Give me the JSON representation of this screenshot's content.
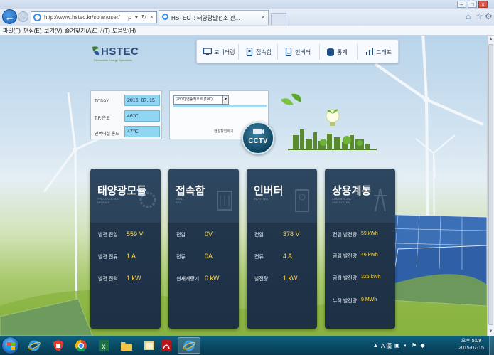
{
  "browser": {
    "url": "http://www.hstec.kr/solar/user/",
    "tab_title": "HSTEC :: 태양광발전소 관...",
    "tab_close": "×",
    "menu": [
      "파일(F)",
      "편집(E)",
      "보기(V)",
      "즐겨찾기(A)",
      "도구(T)",
      "도움말(H)"
    ],
    "address_tools": "ρ ▾ ↻ ×",
    "window_controls": [
      "–",
      "□",
      "×"
    ]
  },
  "logo": {
    "text": "HSTEC",
    "subtext": "Renewable Energy Specialists"
  },
  "nav": [
    {
      "label": "모니터링",
      "icon": "monitor-icon"
    },
    {
      "label": "접속함",
      "icon": "junction-box-icon"
    },
    {
      "label": "인버터",
      "icon": "inverter-icon"
    },
    {
      "label": "통계",
      "icon": "statistics-icon"
    },
    {
      "label": "그래프",
      "icon": "graph-icon"
    }
  ],
  "env": {
    "today_label": "TODAY",
    "today_value": "2015. 07. 15",
    "tr_label": "T.R 온도",
    "tr_value": "46℃",
    "inverter_label": "인버터실 온도",
    "inverter_value": "47℃"
  },
  "cctv": {
    "select_value": "[7807] 연송커오르 (10K)",
    "link": "현장확인하기",
    "button_label": "CCTV"
  },
  "cards": [
    {
      "title": "태양광모듈",
      "subtitle": "PHOTOVOLTAIC\nMODULE",
      "rows": [
        {
          "label": "발전 전압",
          "value": "559 V"
        },
        {
          "label": "발전 전류",
          "value": "1 A"
        },
        {
          "label": "발전 전력",
          "value": "1 kW"
        }
      ]
    },
    {
      "title": "접속함",
      "subtitle": "JOINT\nBOX",
      "rows": [
        {
          "label": "전압",
          "value": "0V"
        },
        {
          "label": "전류",
          "value": "0A"
        },
        {
          "label": "현재계량기",
          "value": "0 kW"
        }
      ]
    },
    {
      "title": "인버터",
      "subtitle": "INVERTER",
      "rows": [
        {
          "label": "전압",
          "value": "378 V"
        },
        {
          "label": "전류",
          "value": "4 A"
        },
        {
          "label": "발전량",
          "value": "1 kW"
        }
      ]
    },
    {
      "title": "상용계통",
      "subtitle": "COMMERCIAL\nUSE SYSTEM",
      "rows": [
        {
          "label": "전일 발전량",
          "value": "59 kWh"
        },
        {
          "label": "금일 발전량",
          "value": "46 kWh"
        },
        {
          "label": "금월 발전량",
          "value": "326 kWh"
        },
        {
          "label": "누적 발전량",
          "value": "9 MWh"
        }
      ]
    }
  ],
  "taskbar": {
    "apps": [
      "internet-explorer-icon",
      "shield-app-icon",
      "chrome-icon",
      "excel-icon",
      "folder-icon",
      "acrobat-icon",
      "web-app-icon"
    ],
    "tray_text": "A 漢",
    "clock_time": "오후 5:09",
    "clock_date": "2015-07-15"
  },
  "colors": {
    "card_bg": "#2e4760",
    "value_accent": "#ffd84a",
    "env_value_bg": "#8fd6f2",
    "taskbar": "#0b5573"
  }
}
